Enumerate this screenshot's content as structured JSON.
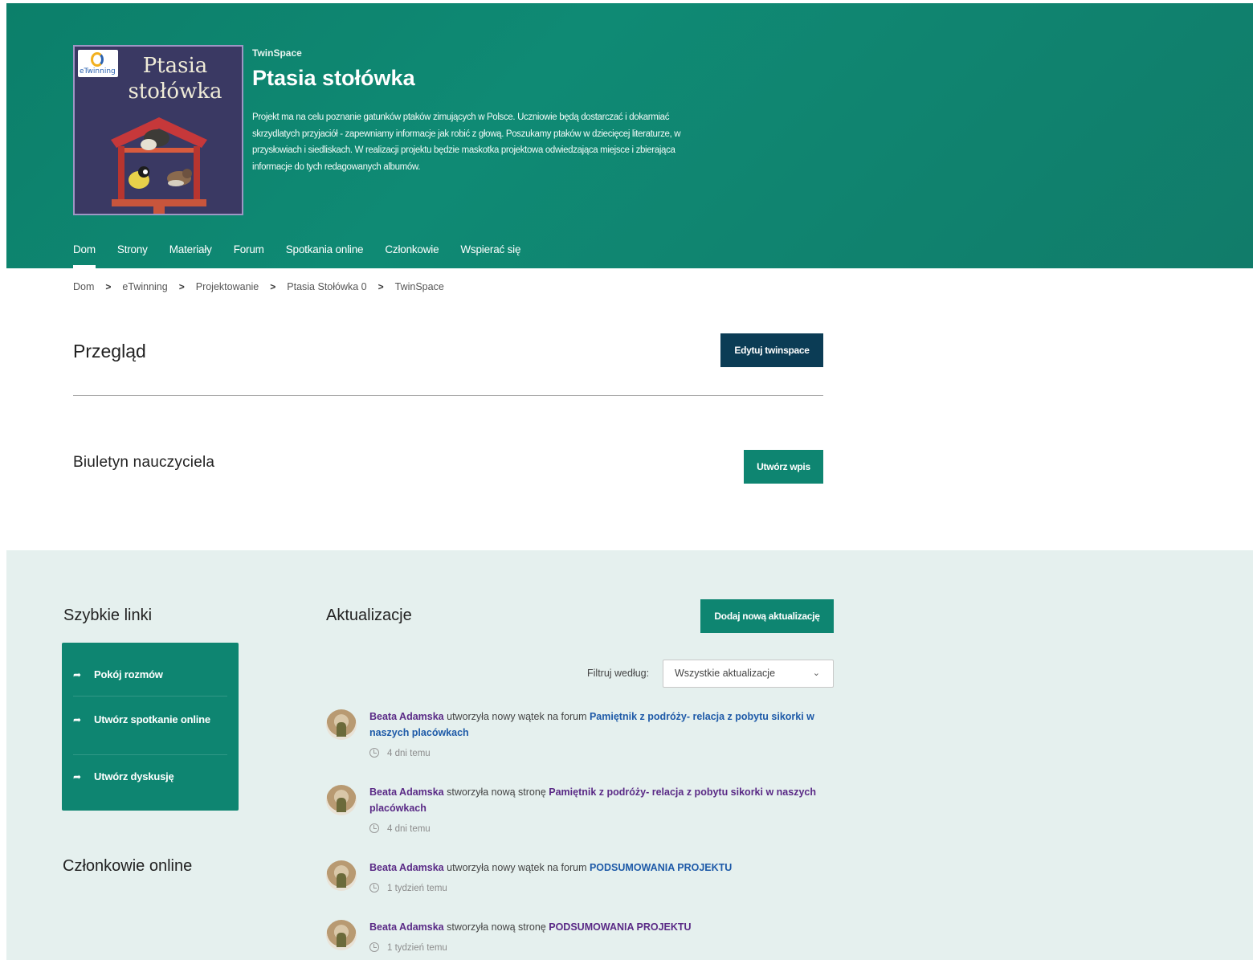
{
  "hero": {
    "cover_title": "Ptasia stołówka",
    "cover_logo_text": "eTwinning",
    "kicker": "TwinSpace",
    "title": "Ptasia stołówka",
    "description": "Projekt ma na celu poznanie gatunków ptaków zimujących w Polsce. Uczniowie będą dostarczać i dokarmiać skrzydlatych przyjaciół - zapewniamy informacje jak robić z głową. Poszukamy ptaków w dziecięcej literaturze, w przysłowiach i siedliskach. W realizacji projektu będzie maskotka projektowa odwiedzająca miejsce i zbierająca informacje do tych redagowanych albumów."
  },
  "nav": {
    "items": [
      {
        "label": "Dom",
        "active": true
      },
      {
        "label": "Strony"
      },
      {
        "label": "Materiały"
      },
      {
        "label": "Forum"
      },
      {
        "label": "Spotkania online"
      },
      {
        "label": "Członkowie"
      },
      {
        "label": "Wspierać się"
      }
    ]
  },
  "breadcrumb": [
    "Dom",
    "eTwinning",
    "Projektowanie",
    "Ptasia Stołówka 0",
    "TwinSpace"
  ],
  "overview": {
    "title": "Przegląd",
    "edit_button": "Edytuj twinspace"
  },
  "bulletin": {
    "title": "Biuletyn nauczyciela",
    "create_button": "Utwórz wpis"
  },
  "quick_links": {
    "title": "Szybkie linki",
    "items": [
      {
        "label": "Pokój rozmów"
      },
      {
        "label": "Utwórz spotkanie online"
      },
      {
        "label": "Utwórz dyskusję"
      }
    ]
  },
  "members_online": {
    "title": "Członkowie online"
  },
  "updates": {
    "title": "Aktualizacje",
    "add_button": "Dodaj nową aktualizację",
    "filter_label": "Filtruj według:",
    "filter_value": "Wszystkie aktualizacje",
    "items": [
      {
        "author": "Beata Adamska",
        "action": " utworzyła nowy wątek na forum ",
        "link": "Pamiętnik z podróży- relacja z pobytu sikorki w naszych placówkach",
        "time": "4 dni temu"
      },
      {
        "author": "Beata Adamska",
        "action": " stworzyła nową stronę ",
        "link": "Pamiętnik z podróży- relacja z pobytu sikorki w naszych placówkach",
        "time": "4 dni temu"
      },
      {
        "author": "Beata Adamska",
        "action": " utworzyła nowy wątek na forum ",
        "link": "PODSUMOWANIA PROJEKTU",
        "time": "1 tydzień temu"
      },
      {
        "author": "Beata Adamska",
        "action": " stworzyła nową stronę ",
        "link": "PODSUMOWANIA PROJEKTU",
        "time": "1 tydzień temu"
      }
    ]
  }
}
